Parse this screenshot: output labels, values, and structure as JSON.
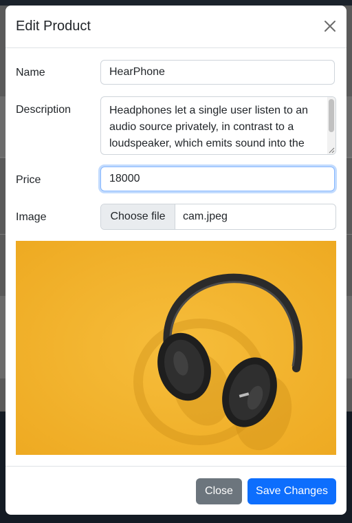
{
  "modal": {
    "title": "Edit Product",
    "close_icon": "close-x-icon"
  },
  "form": {
    "name_label": "Name",
    "name_value": "HearPhone",
    "description_label": "Description",
    "description_value": "Headphones let a single user listen to an audio source privately, in contrast to a loudspeaker, which emits sound into the open air for anyone nearby to hear.",
    "price_label": "Price",
    "price_value": "18000",
    "image_label": "Image",
    "choose_file_label": "Choose file",
    "file_name": "cam.jpeg"
  },
  "preview": {
    "icon": "headphones-image",
    "background_color": "#f2b12c"
  },
  "footer": {
    "close_label": "Close",
    "save_label": "Save Changes"
  },
  "colors": {
    "primary": "#0d6efd",
    "secondary": "#6c757d"
  }
}
